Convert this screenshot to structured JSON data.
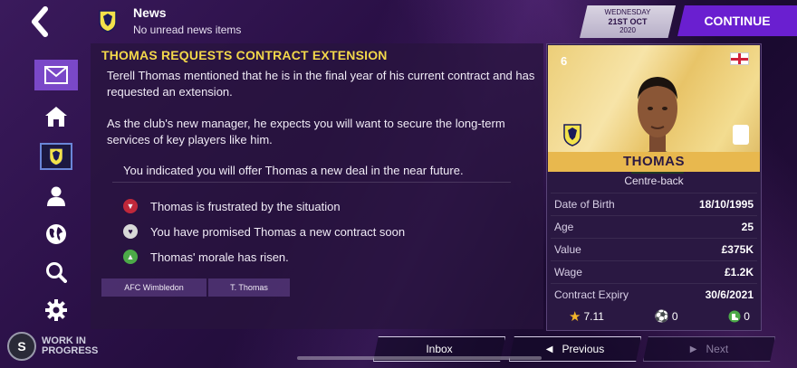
{
  "header": {
    "back_icon": "back-arrow-icon",
    "section_title": "News",
    "section_subtitle": "No unread news items",
    "date": {
      "weekday": "WEDNESDAY",
      "day_month": "21ST OCT",
      "year": "2020"
    },
    "continue_label": "CONTINUE"
  },
  "sidebar": {
    "items": [
      {
        "name": "inbox",
        "icon": "mail-icon",
        "active": true
      },
      {
        "name": "home",
        "icon": "home-icon"
      },
      {
        "name": "club",
        "icon": "club-crest-icon"
      },
      {
        "name": "squad",
        "icon": "person-icon"
      },
      {
        "name": "world",
        "icon": "globe-icon"
      },
      {
        "name": "search",
        "icon": "search-icon"
      },
      {
        "name": "settings",
        "icon": "gear-icon"
      }
    ]
  },
  "message": {
    "title": "THOMAS REQUESTS CONTRACT EXTENSION",
    "paragraphs": [
      "Terell Thomas mentioned that he is in the final year of his current contract and has requested an extension.",
      "As the club's new manager, he expects you will want to secure the long-term services of key players like him."
    ],
    "response": "You indicated you will offer Thomas a new deal in the near future.",
    "effects": [
      {
        "text": "Thomas is frustrated by the situation",
        "color": "#c0283a"
      },
      {
        "text": "You have promised Thomas a new contract soon",
        "color": "#d8d8d8"
      },
      {
        "text": "Thomas' morale has risen.",
        "color": "#4caa48"
      }
    ],
    "tags": [
      "AFC Wimbledon",
      "T. Thomas"
    ]
  },
  "player_card": {
    "number": "6",
    "name": "THOMAS",
    "position": "Centre-back",
    "stats": [
      {
        "label": "Date of Birth",
        "value": "18/10/1995"
      },
      {
        "label": "Age",
        "value": "25"
      },
      {
        "label": "Value",
        "value": "£375K"
      },
      {
        "label": "Wage",
        "value": "£1.2K"
      },
      {
        "label": "Contract Expiry",
        "value": "30/6/2021"
      }
    ],
    "rating": "7.11",
    "goals": "0",
    "assists": "0"
  },
  "footer": {
    "wip_line1": "WORK IN",
    "wip_line2": "PROGRESS",
    "inbox_label": "Inbox",
    "previous_label": "Previous",
    "next_label": "Next"
  }
}
